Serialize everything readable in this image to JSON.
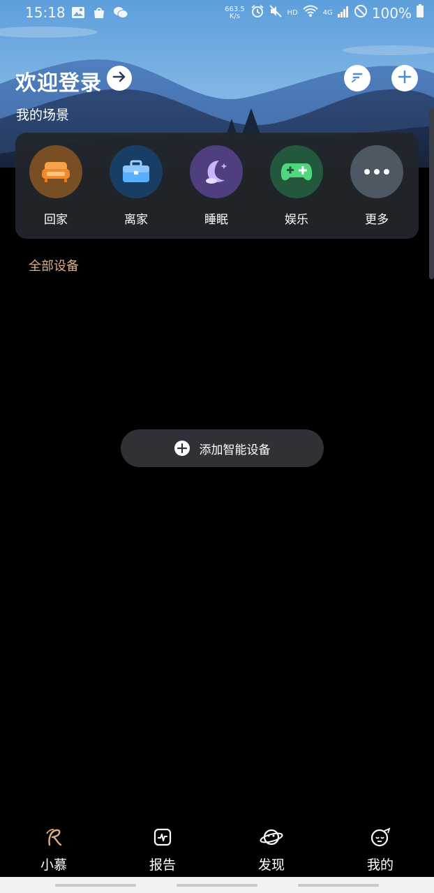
{
  "status_bar": {
    "time": "15:18",
    "net_speed_value": "663.5",
    "net_speed_unit": "K/s",
    "hd": "HD",
    "network": "4G",
    "battery": "100%",
    "icons": [
      "gallery-icon",
      "shopping-bag-icon",
      "wechat-icon",
      "alarm-icon",
      "mute-icon",
      "wifi-icon",
      "signal-icon",
      "dnd-icon",
      "battery-icon"
    ]
  },
  "header": {
    "welcome_login": "欢迎登录",
    "my_scenes": "我的场景"
  },
  "scenes": [
    {
      "label": "回家",
      "icon": "sofa-icon",
      "color": "#8a5a2a"
    },
    {
      "label": "离家",
      "icon": "briefcase-icon",
      "color": "#1f4a75"
    },
    {
      "label": "睡眠",
      "icon": "moon-icon",
      "color": "#5a4a8a"
    },
    {
      "label": "娱乐",
      "icon": "gamepad-icon",
      "color": "#2f6a4a"
    },
    {
      "label": "更多",
      "icon": "more-icon",
      "color": "#525c66"
    }
  ],
  "devices": {
    "all_devices_label": "全部设备",
    "add_device_label": "添加智能设备"
  },
  "tabs": [
    {
      "label": "小慕",
      "icon": "xiaomu-logo-icon",
      "active": true
    },
    {
      "label": "报告",
      "icon": "report-icon",
      "active": false
    },
    {
      "label": "发现",
      "icon": "planet-icon",
      "active": false
    },
    {
      "label": "我的",
      "icon": "profile-face-icon",
      "active": false
    }
  ],
  "colors": {
    "accent_gold": "#dcae86",
    "card_bg": "#22262c",
    "button_bg": "#2f3136"
  }
}
